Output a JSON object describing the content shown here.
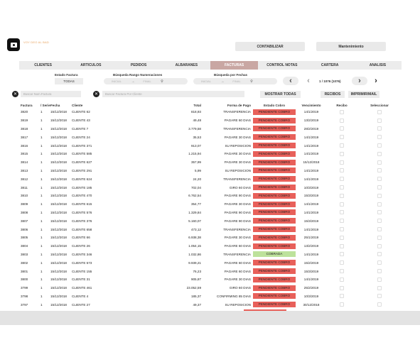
{
  "app": {
    "subtitle": "VOY DEO AL BAD"
  },
  "top_buttons": {
    "contabilizar": "CONTABILIZAR",
    "mantenimiento": "Mantenimiento"
  },
  "tabs": [
    "CLIENTES",
    "ARTICULOS",
    "PEDIDOS",
    "ALBARANES",
    "FACTURAS",
    "CONTROL NOTAS",
    "CARTERA",
    "ANALISIS"
  ],
  "active_tab": "FACTURAS",
  "filters": {
    "estado_label": "Estado Factura",
    "estado_value": "TODAS",
    "rango_label": "Búsqueda Rango Numeraciones",
    "rango_inicial": "INICIAL",
    "rango_final": "FINAL",
    "fechas_label": "Búsqueda por Fechas",
    "fechas_inicial": "INICIAL",
    "fechas_final": "FINAL",
    "page_info": "1 / 1076 (1076)"
  },
  "search": {
    "num_placeholder": "Buscar Num.Factura",
    "cliente_placeholder": "Buscar Factura Por Cliente",
    "mostrar_todas": "MOSTRAR TODAS",
    "recibos": "RECIBOS",
    "imprimir": "IMPRIMIR/MAIL"
  },
  "icons": {
    "clear": "close-circle-icon",
    "search": "magnifier-icon",
    "prev": "chevron-left-icon",
    "next": "chevron-right-icon",
    "arrow": "arrow-right-icon"
  },
  "colors": {
    "active_tab": "#c9a7a3",
    "pendiente": "#e8605a",
    "cobrada": "#bde29b",
    "accent": "#e8a35e"
  },
  "table": {
    "headers": {
      "factura": "Factura",
      "serie": "/ Serie",
      "fecha": "Fecha",
      "cliente": "Cliente",
      "total": "Total",
      "forma_pago": "Forma de Pago",
      "estado": "Estado Cobro",
      "vencimiento": "Vencimiento",
      "recibo": "Recibo",
      "seleccionar": "Seleccionar"
    },
    "rows": [
      {
        "num": "3820",
        "serie": "1",
        "fecha": "15/12/2018",
        "cliente": "CLIENTE 62",
        "total": "818,93",
        "pago": "TRANSFERENCIA",
        "estado": "PENDIENTE COBRO",
        "venc": "14/1/2019"
      },
      {
        "num": "3819",
        "serie": "1",
        "fecha": "15/12/2018",
        "cliente": "CLIENTE 43",
        "total": "49,48",
        "pago": "PAGARE 60 DIAS",
        "estado": "PENDIENTE COBRO",
        "venc": "13/2/2019"
      },
      {
        "num": "3818",
        "serie": "1",
        "fecha": "15/12/2018",
        "cliente": "CLIENTE 7",
        "total": "3.779,58",
        "pago": "TRANSFERENCIA",
        "estado": "PENDIENTE COBRO",
        "venc": "28/2/2019"
      },
      {
        "num": "3817",
        "serie": "1",
        "fecha": "15/12/2018",
        "cliente": "CLIENTE 24",
        "total": "35,53",
        "pago": "PAGARE 30 DIAS",
        "estado": "PENDIENTE COBRO",
        "venc": "14/1/2019"
      },
      {
        "num": "3816",
        "serie": "1",
        "fecha": "15/12/2018",
        "cliente": "CLIENTE 371",
        "total": "913,07",
        "pago": "SU REPOSICION",
        "estado": "PENDIENTE COBRO",
        "venc": "14/1/2019"
      },
      {
        "num": "3815",
        "serie": "1",
        "fecha": "15/12/2018",
        "cliente": "CLIENTE 585",
        "total": "1.215,94",
        "pago": "PAGARE 30 DIAS",
        "estado": "PENDIENTE COBRO",
        "venc": "14/1/2019"
      },
      {
        "num": "3814",
        "serie": "1",
        "fecha": "15/12/2018",
        "cliente": "CLIENTE 627",
        "total": "357,99",
        "pago": "PAGARE 30 DIAS",
        "estado": "PENDIENTE COBRO",
        "venc": "15/12/2018"
      },
      {
        "num": "3813",
        "serie": "1",
        "fecha": "15/12/2018",
        "cliente": "CLIENTE 291",
        "total": "5,99",
        "pago": "SU REPOSICION",
        "estado": "PENDIENTE COBRO",
        "venc": "14/1/2019"
      },
      {
        "num": "3812",
        "serie": "1",
        "fecha": "15/12/2018",
        "cliente": "CLIENTE 624",
        "total": "24,20",
        "pago": "TRANSFERENCIA",
        "estado": "PENDIENTE COBRO",
        "venc": "14/1/2019"
      },
      {
        "num": "3811",
        "serie": "1",
        "fecha": "15/12/2018",
        "cliente": "CLIENTE 185",
        "total": "702,04",
        "pago": "GIRO 60 DIAS",
        "estado": "PENDIENTE COBRO",
        "venc": "10/3/2019"
      },
      {
        "num": "3810",
        "serie": "1",
        "fecha": "15/12/2018",
        "cliente": "CLIENTE 470",
        "total": "6.762,54",
        "pago": "PAGARE 90 DIAS",
        "estado": "PENDIENTE COBRO",
        "venc": "15/3/2019"
      },
      {
        "num": "3809",
        "serie": "1",
        "fecha": "15/12/2018",
        "cliente": "CLIENTE 615",
        "total": "354,77",
        "pago": "PAGARE 30 DIAS",
        "estado": "PENDIENTE COBRO",
        "venc": "14/1/2019"
      },
      {
        "num": "3808",
        "serie": "1",
        "fecha": "15/12/2018",
        "cliente": "CLIENTE 576",
        "total": "1.329,84",
        "pago": "PAGARE 90 DIAS",
        "estado": "PENDIENTE COBRO",
        "venc": "14/1/2019"
      },
      {
        "num": "3807",
        "serie": "1",
        "fecha": "15/12/2018",
        "cliente": "CLIENTE 376",
        "total": "5.160,07",
        "pago": "PAGARE 90 DIAS",
        "estado": "PENDIENTE COBRO",
        "venc": "15/3/2019"
      },
      {
        "num": "3806",
        "serie": "1",
        "fecha": "15/12/2018",
        "cliente": "CLIENTE 658",
        "total": "473,12",
        "pago": "TRANSFERENCIA",
        "estado": "PENDIENTE COBRO",
        "venc": "14/1/2019"
      },
      {
        "num": "3805",
        "serie": "1",
        "fecha": "15/12/2018",
        "cliente": "CLIENTE 66",
        "total": "6.938,38",
        "pago": "PAGARE 30 DIAS",
        "estado": "PENDIENTE COBRO",
        "venc": "25/1/2019"
      },
      {
        "num": "3804",
        "serie": "1",
        "fecha": "15/12/2018",
        "cliente": "CLIENTE 26",
        "total": "1.054,15",
        "pago": "PAGARE 60 DIAS",
        "estado": "PENDIENTE COBRO",
        "venc": "13/2/2019"
      },
      {
        "num": "3803",
        "serie": "1",
        "fecha": "15/12/2018",
        "cliente": "CLIENTE 346",
        "total": "1.032,86",
        "pago": "TRANSFERENCIA",
        "estado": "COBRADA",
        "venc": "14/1/2019"
      },
      {
        "num": "3802",
        "serie": "1",
        "fecha": "15/12/2018",
        "cliente": "CLIENTE 573",
        "total": "9.939,21",
        "pago": "PAGARE 60 DIAS",
        "estado": "PENDIENTE COBRO",
        "venc": "15/2/2019"
      },
      {
        "num": "3801",
        "serie": "1",
        "fecha": "15/12/2018",
        "cliente": "CLIENTE 155",
        "total": "76,23",
        "pago": "PAGARE 60 DIAS",
        "estado": "PENDIENTE COBRO",
        "venc": "15/3/2019"
      },
      {
        "num": "3800",
        "serie": "1",
        "fecha": "15/12/2018",
        "cliente": "CLIENTE 31",
        "total": "905,87",
        "pago": "PAGARE 30 DIAS",
        "estado": "PENDIENTE COBRO",
        "venc": "14/1/2019"
      },
      {
        "num": "3799",
        "serie": "1",
        "fecha": "15/12/2018",
        "cliente": "CLIENTE 461",
        "total": "23.052,59",
        "pago": "GIRO 60 DIAS",
        "estado": "PENDIENTE COBRO",
        "venc": "25/2/2019"
      },
      {
        "num": "3798",
        "serie": "1",
        "fecha": "15/12/2018",
        "cliente": "CLIENTE 4",
        "total": "185,37",
        "pago": "CONFIRMING 85 DIAS",
        "estado": "PENDIENTE COBRO",
        "venc": "10/3/2019"
      },
      {
        "num": "3797",
        "serie": "1",
        "fecha": "15/12/2018",
        "cliente": "CLIENTE 27",
        "total": "49,37",
        "pago": "SU REPOSICION",
        "estado": "PENDIENTE COBRO",
        "venc": "30/12/2018"
      }
    ]
  }
}
